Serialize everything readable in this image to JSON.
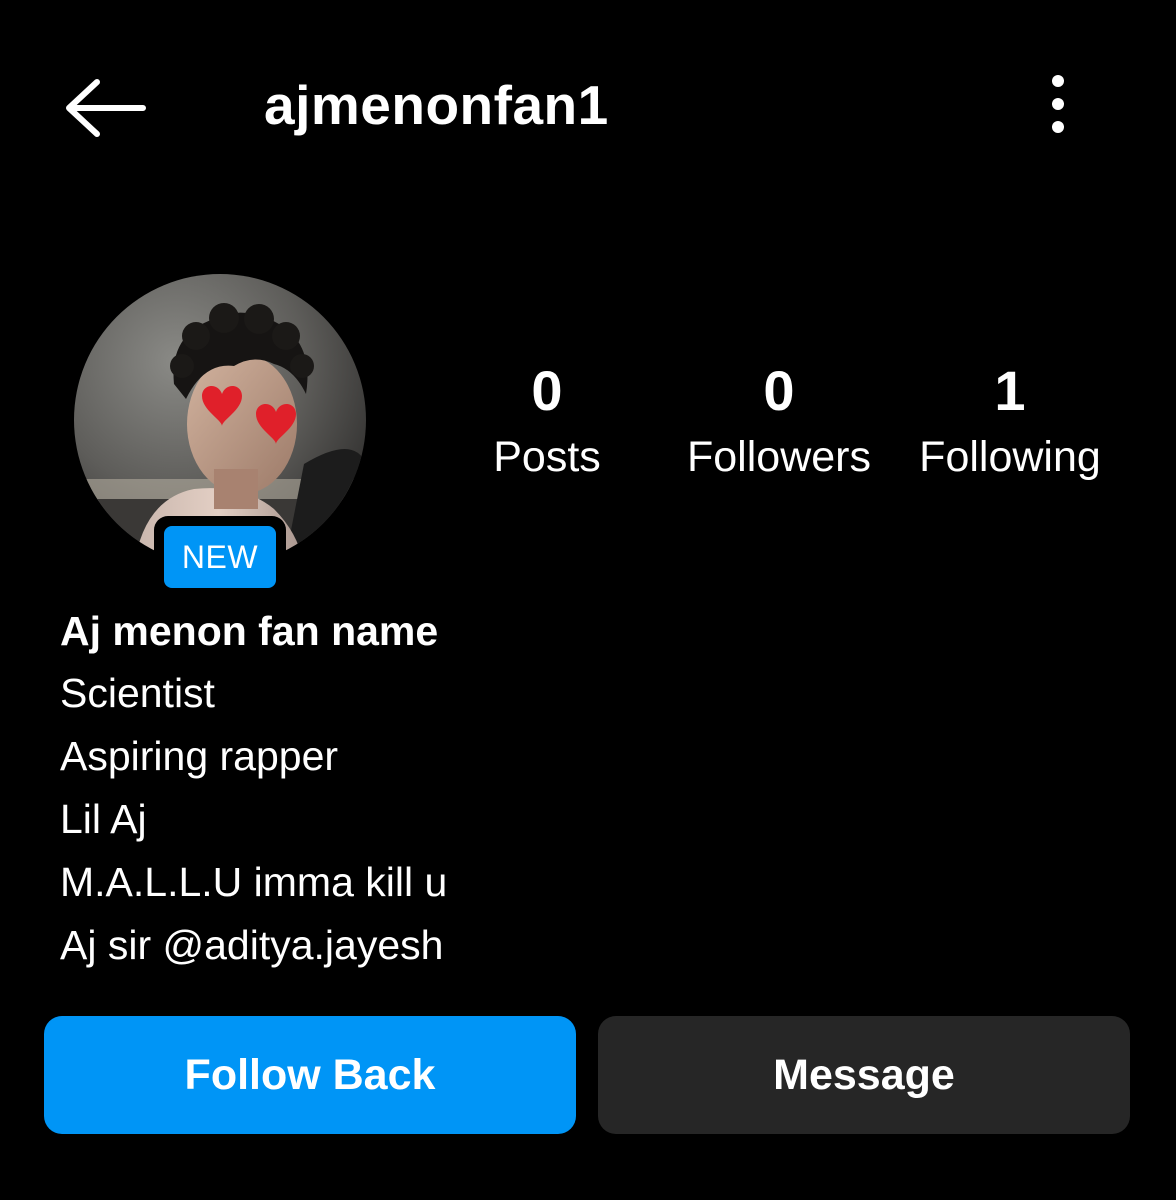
{
  "header": {
    "username": "ajmenonfan1",
    "back_icon": "back-arrow-icon",
    "more_icon": "vertical-dots-icon"
  },
  "profile": {
    "badge": "NEW",
    "badge_color": "#0095f6"
  },
  "stats": [
    {
      "count": "0",
      "label": "Posts"
    },
    {
      "count": "0",
      "label": "Followers"
    },
    {
      "count": "1",
      "label": "Following"
    }
  ],
  "bio": {
    "name": "Aj menon fan name",
    "lines": [
      "Scientist",
      "Aspiring rapper",
      "Lil Aj",
      "M.A.L.L.U imma kill u",
      "Aj sir @aditya.jayesh"
    ]
  },
  "actions": {
    "follow_back_label": "Follow Back",
    "message_label": "Message",
    "primary_color": "#0095f6",
    "secondary_color": "#262626"
  }
}
